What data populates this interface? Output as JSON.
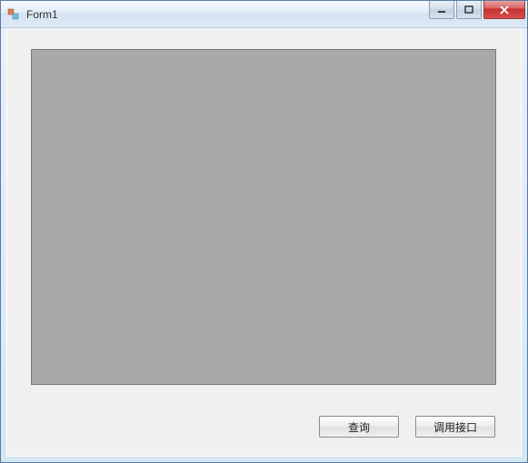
{
  "window": {
    "title": "Form1"
  },
  "buttons": {
    "query": "查询",
    "invoke": "调用接口"
  }
}
